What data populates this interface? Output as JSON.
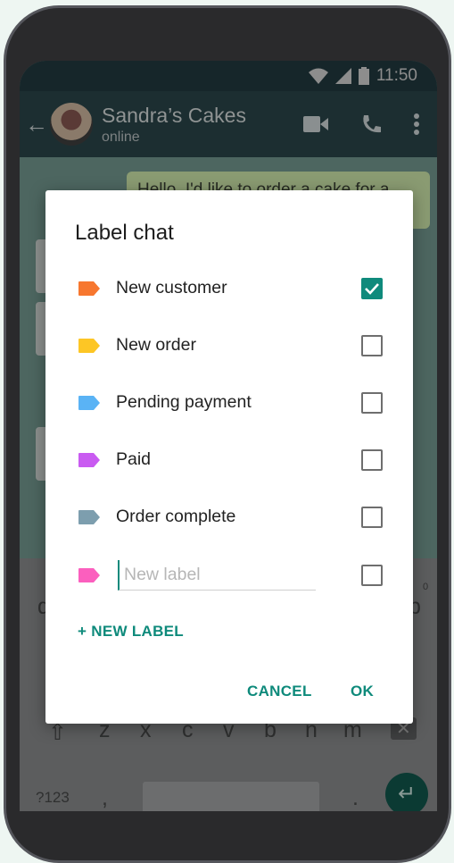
{
  "status": {
    "time": "11:50"
  },
  "chat": {
    "name": "Sandra’s Cakes",
    "status": "online",
    "message": "Hello, I'd like to order a cake for a"
  },
  "keyboard": {
    "row3": [
      "z",
      "x",
      "c",
      "v",
      "b",
      "n",
      "m"
    ],
    "symbols": "?123",
    "comma": ",",
    "period": ".",
    "row1_left": "q",
    "row1_right": "p",
    "hint": "0"
  },
  "dialog": {
    "title": "Label chat",
    "labels": [
      {
        "name": "New customer",
        "color": "#f7772f",
        "checked": true
      },
      {
        "name": "New order",
        "color": "#fdc625",
        "checked": false
      },
      {
        "name": "Pending payment",
        "color": "#5ab3f5",
        "checked": false
      },
      {
        "name": "Paid",
        "color": "#c95bf1",
        "checked": false
      },
      {
        "name": "Order complete",
        "color": "#7d9eae",
        "checked": false
      }
    ],
    "new_label": {
      "placeholder": "New label",
      "value": "",
      "color": "#fb5fbe",
      "checked": false
    },
    "add_button": "+ NEW LABEL",
    "cancel": "CANCEL",
    "ok": "OK"
  },
  "accent": "#0e8a7b"
}
